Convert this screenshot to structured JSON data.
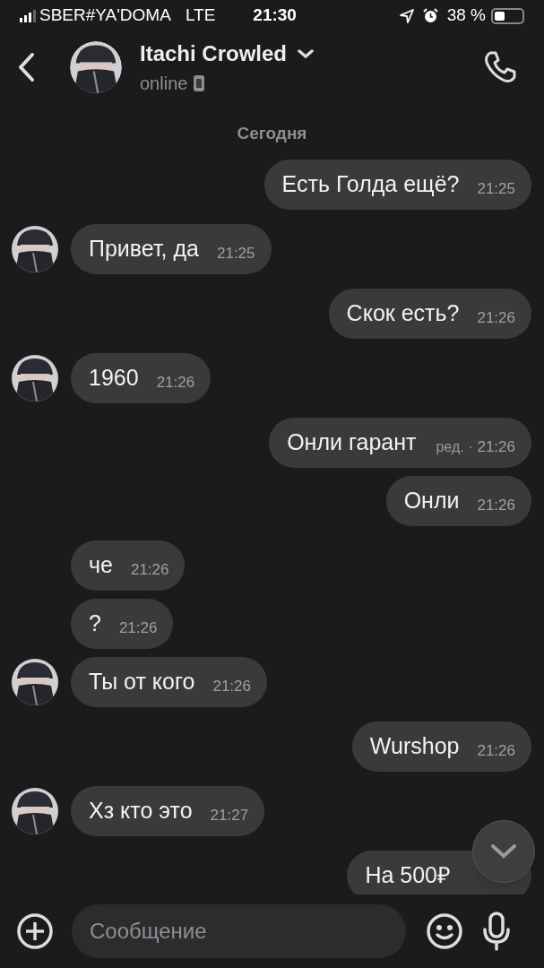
{
  "status_bar": {
    "carrier": "SBER#YA'DOMA",
    "network": "LTE",
    "time": "21:30",
    "battery": "38 %"
  },
  "header": {
    "name": "Itachi Crowled",
    "status": "online"
  },
  "date_divider": "Сегодня",
  "messages": [
    {
      "kind": "outgoing",
      "text": "Есть Голда ещё?",
      "time": "21:25"
    },
    {
      "kind": "incoming",
      "text": "Привет, да",
      "time": "21:25",
      "avatar": true
    },
    {
      "kind": "outgoing",
      "text": "Скок есть?",
      "time": "21:26"
    },
    {
      "kind": "incoming",
      "text": "1960",
      "time": "21:26",
      "avatar": true
    },
    {
      "kind": "outgoing",
      "text": "Онли гарант",
      "edited_note": "ред. ·",
      "time": "21:26"
    },
    {
      "kind": "outgoing",
      "text": "Онли",
      "time": "21:26"
    },
    {
      "kind": "incoming",
      "text": "че",
      "time": "21:26",
      "avatar": false
    },
    {
      "kind": "incoming",
      "text": "?",
      "time": "21:26",
      "avatar": false
    },
    {
      "kind": "incoming",
      "text": "Ты от кого",
      "time": "21:26",
      "avatar": true
    },
    {
      "kind": "outgoing",
      "text": "Wurshop",
      "time": "21:26"
    },
    {
      "kind": "incoming",
      "text": "Хз кто это",
      "time": "21:27",
      "avatar": true
    },
    {
      "kind": "outgoing",
      "text": "На 500₽"
    }
  ],
  "composer": {
    "placeholder": "Сообщение"
  }
}
